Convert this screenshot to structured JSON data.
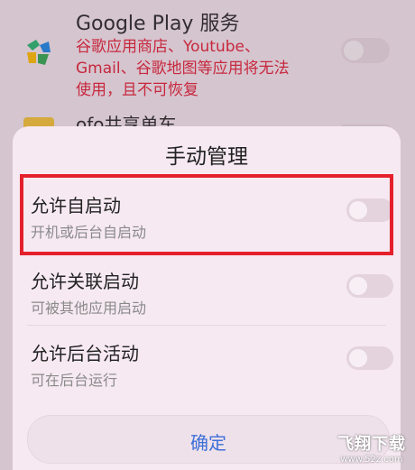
{
  "background_app": {
    "title": "Google Play 服务",
    "warning_lines": [
      "谷歌应用商店、Youtube、",
      "Gmail、谷歌地图等应用将无法",
      "使用，且不可恢复"
    ],
    "second_item_title": "ofo共享单车",
    "icon": "google-play-services-icon"
  },
  "dialog": {
    "title": "手动管理",
    "rows": [
      {
        "label": "允许自启动",
        "sub": "开机或后台自启动",
        "enabled": false
      },
      {
        "label": "允许关联启动",
        "sub": "可被其他应用启动",
        "enabled": false
      },
      {
        "label": "允许后台活动",
        "sub": "可在后台运行",
        "enabled": false
      }
    ],
    "confirm_label": "确定"
  },
  "watermark": {
    "line1": "飞翔下载",
    "line2": "www.52z.com"
  },
  "colors": {
    "highlight": "#e4202c",
    "accent": "#3d6fd8",
    "warning": "#e0243a"
  }
}
